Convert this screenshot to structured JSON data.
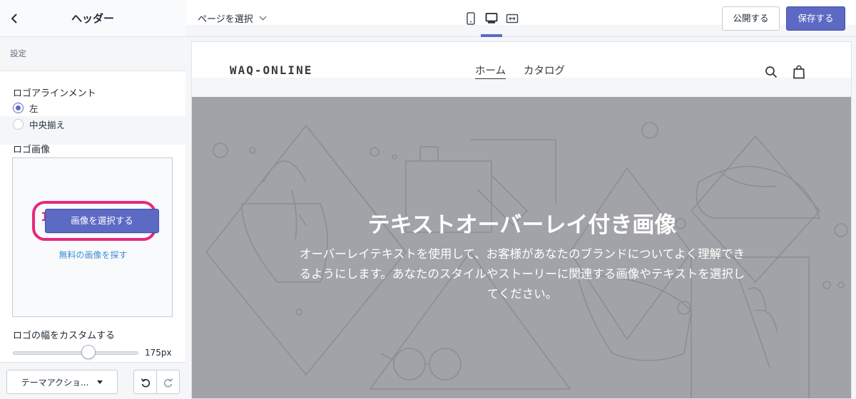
{
  "sidebar": {
    "title": "ヘッダー",
    "section_label": "設定",
    "logo_alignment": {
      "label": "ロゴアラインメント",
      "options": [
        "左",
        "中央揃え"
      ],
      "selected": "左"
    },
    "logo_image": {
      "label": "ロゴ画像",
      "step_number": "1",
      "select_button": "画像を選択する",
      "free_images_link": "無料の画像を探す"
    },
    "logo_width": {
      "label": "ロゴの幅をカスタムする",
      "value": "175px",
      "value_fraction": 0.6
    },
    "footer": {
      "theme_actions": "テーマアクショ..."
    }
  },
  "topbar": {
    "page_select": "ページを選択",
    "devices": [
      "mobile-icon",
      "desktop-icon",
      "fullscreen-icon"
    ],
    "active_device": "desktop-icon",
    "publish": "公開する",
    "save": "保存する"
  },
  "preview": {
    "store_name": "WAQ-ONLINE",
    "nav": [
      "ホーム",
      "カタログ"
    ],
    "active_nav": "ホーム",
    "hero": {
      "title": "テキストオーバーレイ付き画像",
      "text": "オーバーレイテキストを使用して、お客様があなたのブランドについてよく理解できるようにします。あなたのスタイルやストーリーに関連する画像やテキストを選択してください。"
    }
  },
  "colors": {
    "accent": "#5c6ac4",
    "highlight": "#e8287b",
    "link": "#3f8ed8",
    "hero_bg": "#a2a3a8"
  }
}
